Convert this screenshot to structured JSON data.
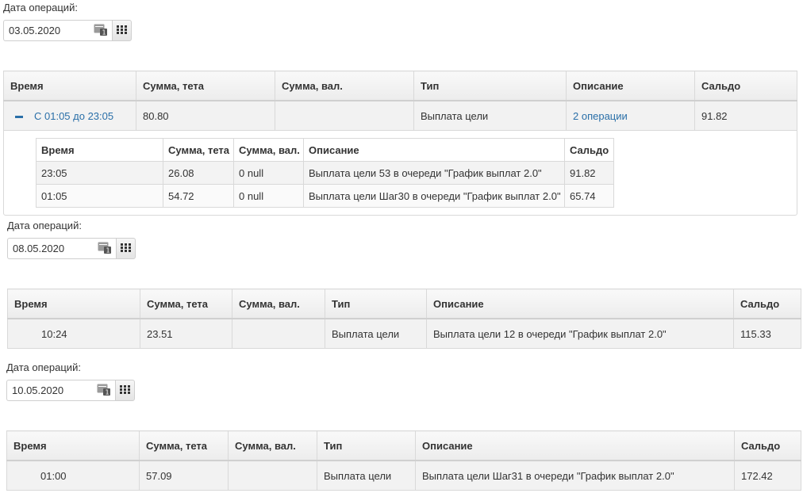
{
  "colors": {
    "link": "#2a6fa8",
    "header_bg": "#ececec",
    "row_bg": "#f2f2f2",
    "border": "#d9d9d9"
  },
  "sections": [
    {
      "date_label": "Дата операций:",
      "date_value": "03.05.2020",
      "headers": [
        "Время",
        "Сумма, тета",
        "Сумма, вал.",
        "Тип",
        "Описание",
        "Сальдо"
      ],
      "group_row": {
        "time": "С 01:05 до 23:05",
        "sum": "80.80",
        "sum_val": "",
        "type": "Выплата цели",
        "description": "2 операции",
        "balance": "91.82"
      },
      "inner_headers": [
        "Время",
        "Сумма, тета",
        "Сумма, вал.",
        "Описание",
        "Сальдо"
      ],
      "inner_rows": [
        {
          "time": "23:05",
          "sum": "26.08",
          "sum_val": "0 null",
          "description": "Выплата цели 53 в очереди \"График выплат 2.0\"",
          "balance": "91.82"
        },
        {
          "time": "01:05",
          "sum": "54.72",
          "sum_val": "0 null",
          "description": "Выплата цели Шаг30 в очереди \"График выплат 2.0\"",
          "balance": "65.74"
        }
      ]
    },
    {
      "date_label": "Дата операций:",
      "date_value": "08.05.2020",
      "headers": [
        "Время",
        "Сумма, тета",
        "Сумма, вал.",
        "Тип",
        "Описание",
        "Сальдо"
      ],
      "rows": [
        {
          "time": "10:24",
          "sum": "23.51",
          "sum_val": "",
          "type": "Выплата цели",
          "description": "Выплата цели 12 в очереди \"График выплат 2.0\"",
          "balance": "115.33"
        }
      ]
    },
    {
      "date_label": "Дата операций:",
      "date_value": "10.05.2020",
      "headers": [
        "Время",
        "Сумма, тета",
        "Сумма, вал.",
        "Тип",
        "Описание",
        "Сальдо"
      ],
      "rows": [
        {
          "time": "01:00",
          "sum": "57.09",
          "sum_val": "",
          "type": "Выплата цели",
          "description": "Выплата цели Шаг31 в очереди \"График выплат 2.0\"",
          "balance": "172.42"
        }
      ]
    }
  ]
}
